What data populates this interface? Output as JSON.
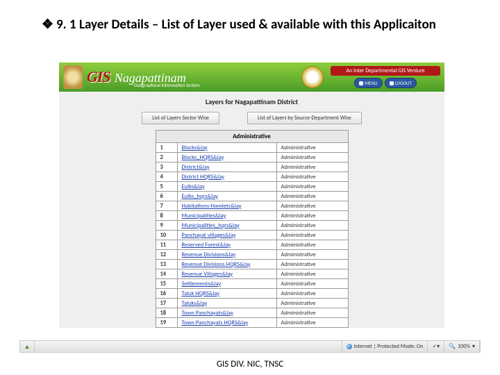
{
  "slide": {
    "bullet": "❖",
    "title": "9. 1 Layer Details – List of Layer used & available with this Applicaiton"
  },
  "header": {
    "gis": "GIS",
    "place": "Nagapattinam",
    "subtitle": "Geographical Information System",
    "venture": "An Inter Departmental GIS Venture",
    "menu": "MENU",
    "logout": "LOGOUT"
  },
  "content": {
    "title": "Layers for Nagapattinam District",
    "tab1": "List of Layers Sector Wise",
    "tab2": "List of Layers by Source-Department Wise",
    "table_header": "Administrative",
    "rows": [
      {
        "n": "1",
        "name": "Blocks&lay",
        "cat": "Administrative"
      },
      {
        "n": "2",
        "name": "Blocks_HQRS&lay",
        "cat": "Administrative"
      },
      {
        "n": "3",
        "name": "District&lay",
        "cat": "Administrative"
      },
      {
        "n": "4",
        "name": "District HQRS&lay",
        "cat": "Administrative"
      },
      {
        "n": "5",
        "name": "Eulks&lay",
        "cat": "Administrative"
      },
      {
        "n": "6",
        "name": "Eulks_hqrs&lay",
        "cat": "Administrative"
      },
      {
        "n": "7",
        "name": "Habitations-Hamlets&lay",
        "cat": "Administrative"
      },
      {
        "n": "8",
        "name": "Municipalities&lay",
        "cat": "Administrative"
      },
      {
        "n": "9",
        "name": "Municipalities_hqrs&lay",
        "cat": "Administrative"
      },
      {
        "n": "10",
        "name": "Panchayat villages&lay",
        "cat": "Administrative"
      },
      {
        "n": "11",
        "name": "Reserved Forest&lay",
        "cat": "Administrative"
      },
      {
        "n": "12",
        "name": "Revenue Divisions&lay",
        "cat": "Administrative"
      },
      {
        "n": "13",
        "name": "Revenue Divisions HQRS&lay",
        "cat": "Administrative"
      },
      {
        "n": "14",
        "name": "Revenue Villages&lay",
        "cat": "Administrative"
      },
      {
        "n": "15",
        "name": "Settlements&lay",
        "cat": "Administrative"
      },
      {
        "n": "16",
        "name": "Taluk HQRS&lay",
        "cat": "Administrative"
      },
      {
        "n": "17",
        "name": "Taluks&lay",
        "cat": "Administrative"
      },
      {
        "n": "18",
        "name": "Town Panchayats&lay",
        "cat": "Administrative"
      },
      {
        "n": "19",
        "name": "Town Panchayats HQRS&lay",
        "cat": "Administrative"
      }
    ]
  },
  "statusbar": {
    "mode": "Internet | Protected Mode: On",
    "zoom": "100%"
  },
  "footer": "GIS DIV. NIC, TNSC"
}
